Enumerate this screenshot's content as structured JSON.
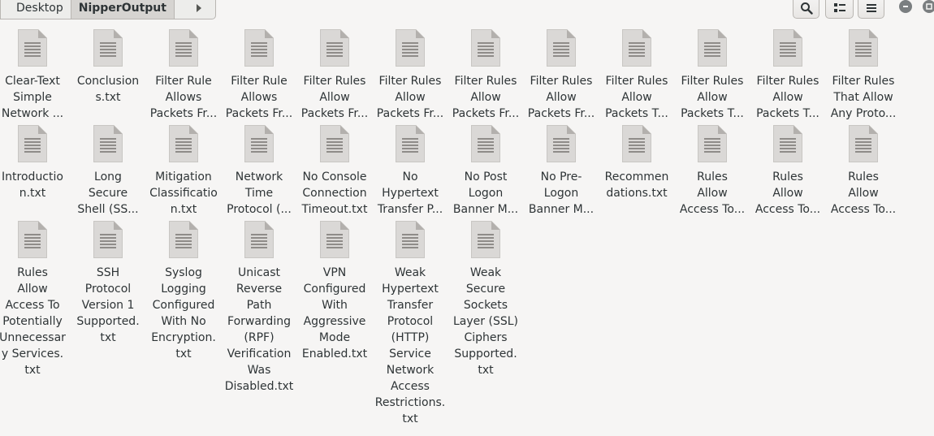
{
  "breadcrumb": {
    "items": [
      {
        "label": "Desktop"
      },
      {
        "label": "NipperOutput"
      }
    ]
  },
  "toolbar": {
    "search_icon": "search-icon",
    "view_icon": "view-options-icon",
    "menu_icon": "hamburger-menu-icon"
  },
  "files": [
    {
      "label": "Clear-Text\nSimple\nNetwork ..."
    },
    {
      "label": "Conclusion\ns.txt"
    },
    {
      "label": "Filter Rule\nAllows\nPackets Fr..."
    },
    {
      "label": "Filter Rule\nAllows\nPackets Fr..."
    },
    {
      "label": "Filter Rules\nAllow\nPackets Fr..."
    },
    {
      "label": "Filter Rules\nAllow\nPackets Fr..."
    },
    {
      "label": "Filter Rules\nAllow\nPackets Fr..."
    },
    {
      "label": "Filter Rules\nAllow\nPackets Fr..."
    },
    {
      "label": "Filter Rules\nAllow\nPackets T..."
    },
    {
      "label": "Filter Rules\nAllow\nPackets T..."
    },
    {
      "label": "Filter Rules\nAllow\nPackets T..."
    },
    {
      "label": "Filter Rules\nThat Allow\nAny Proto..."
    },
    {
      "label": "Introductio\nn.txt"
    },
    {
      "label": "Long\nSecure\nShell (SS..."
    },
    {
      "label": "Mitigation\nClassificatio\nn.txt"
    },
    {
      "label": "Network\nTime\nProtocol (..."
    },
    {
      "label": "No Console\nConnection\nTimeout.txt"
    },
    {
      "label": "No\nHypertext\nTransfer P..."
    },
    {
      "label": "No Post\nLogon\nBanner M..."
    },
    {
      "label": "No Pre-\nLogon\nBanner M..."
    },
    {
      "label": "Recommen\ndations.txt"
    },
    {
      "label": "Rules\nAllow\nAccess To..."
    },
    {
      "label": "Rules\nAllow\nAccess To..."
    },
    {
      "label": "Rules\nAllow\nAccess To..."
    },
    {
      "label": "Rules\nAllow\nAccess To\nPotentially\nUnnecessar\ny Services.\ntxt"
    },
    {
      "label": "SSH\nProtocol\nVersion 1\nSupported.\ntxt"
    },
    {
      "label": "Syslog\nLogging\nConfigured\nWith No\nEncryption.\ntxt"
    },
    {
      "label": "Unicast\nReverse\nPath\nForwarding\n(RPF)\nVerification\nWas\nDisabled.txt"
    },
    {
      "label": "VPN\nConfigured\nWith\nAggressive\nMode\nEnabled.txt"
    },
    {
      "label": "Weak\nHypertext\nTransfer\nProtocol\n(HTTP)\nService\nNetwork\nAccess\nRestrictions.\ntxt"
    },
    {
      "label": "Weak\nSecure\nSockets\nLayer (SSL)\nCiphers\nSupported.\ntxt"
    }
  ]
}
